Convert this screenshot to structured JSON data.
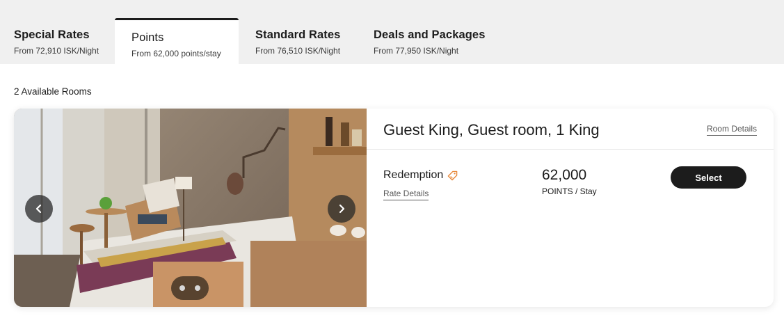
{
  "tabs": [
    {
      "title": "Special Rates",
      "sub": "From 72,910 ISK/Night"
    },
    {
      "title": "Points",
      "sub": "From 62,000 points/stay"
    },
    {
      "title": "Standard Rates",
      "sub": "From 76,510 ISK/Night"
    },
    {
      "title": "Deals and Packages",
      "sub": "From 77,950 ISK/Night"
    }
  ],
  "active_tab": "Points",
  "available_rooms": "2 Available Rooms",
  "room": {
    "title": "Guest King, Guest room, 1 King",
    "details_link": "Room Details",
    "rate_name": "Redemption",
    "rate_details_link": "Rate Details",
    "points": "62,000",
    "points_unit": "POINTS / Stay",
    "select_label": "Select",
    "carousel": {
      "total_images": 2,
      "current_index": 1
    },
    "icons": {
      "prev": "chevron-left-icon",
      "next": "chevron-right-icon",
      "rate_tag": "tag-icon"
    }
  },
  "colors": {
    "accent_tag": "#e8893a",
    "button_bg": "#1c1c1c",
    "tabbar_bg": "#f0f0f0"
  }
}
